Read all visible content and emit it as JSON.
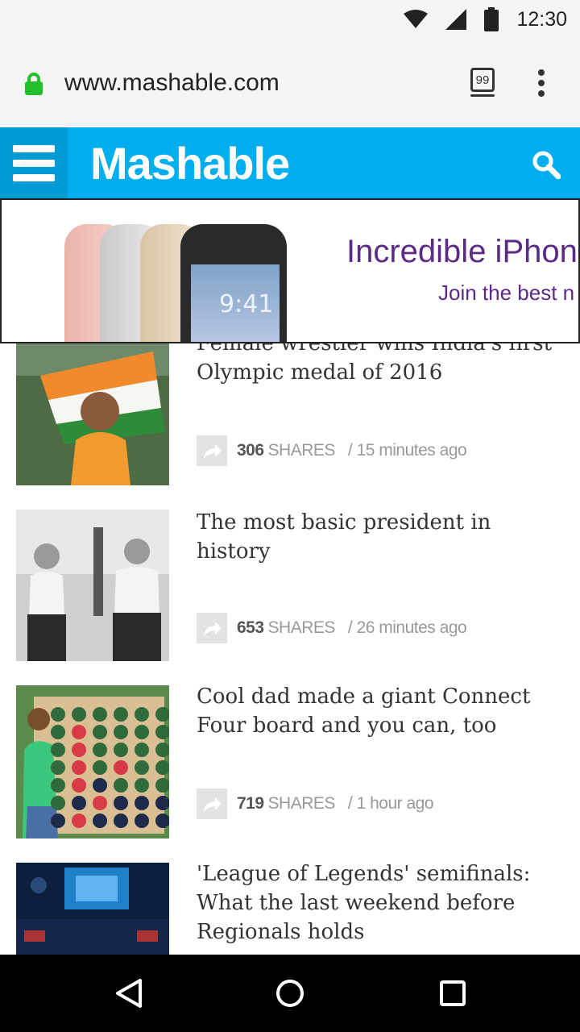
{
  "status_bar": {
    "time": "12:30"
  },
  "browser": {
    "url": "www.mashable.com",
    "tab_count": "99"
  },
  "site": {
    "logo": "Mashable"
  },
  "ad": {
    "headline": "Incredible iPhon",
    "subline": "Join the best n",
    "phone_time": "9:41"
  },
  "articles": [
    {
      "headline_partial": "Female wrestler wins India's first",
      "headline": "Olympic medal of 2016",
      "share_count": "306",
      "shares_label": "SHARES",
      "time": "/ 15 minutes ago"
    },
    {
      "headline": "The most basic president in history",
      "share_count": "653",
      "shares_label": "SHARES",
      "time": "/ 26 minutes ago"
    },
    {
      "headline": "Cool dad made a giant Connect Four board and you can, too",
      "share_count": "719",
      "shares_label": "SHARES",
      "time": "/ 1 hour ago"
    },
    {
      "headline": "'League of Legends' semifinals: What the last weekend before Regionals holds"
    }
  ],
  "colors": {
    "brand_blue": "#00aeef",
    "lock_green": "#22c02a",
    "ad_purple": "#5b2a86"
  },
  "icons": [
    "wifi-icon",
    "cell-signal-icon",
    "battery-icon",
    "lock-icon",
    "tabs-icon",
    "menu-icon",
    "hamburger-icon",
    "search-icon",
    "share-icon",
    "back-icon",
    "home-icon",
    "recents-icon"
  ]
}
